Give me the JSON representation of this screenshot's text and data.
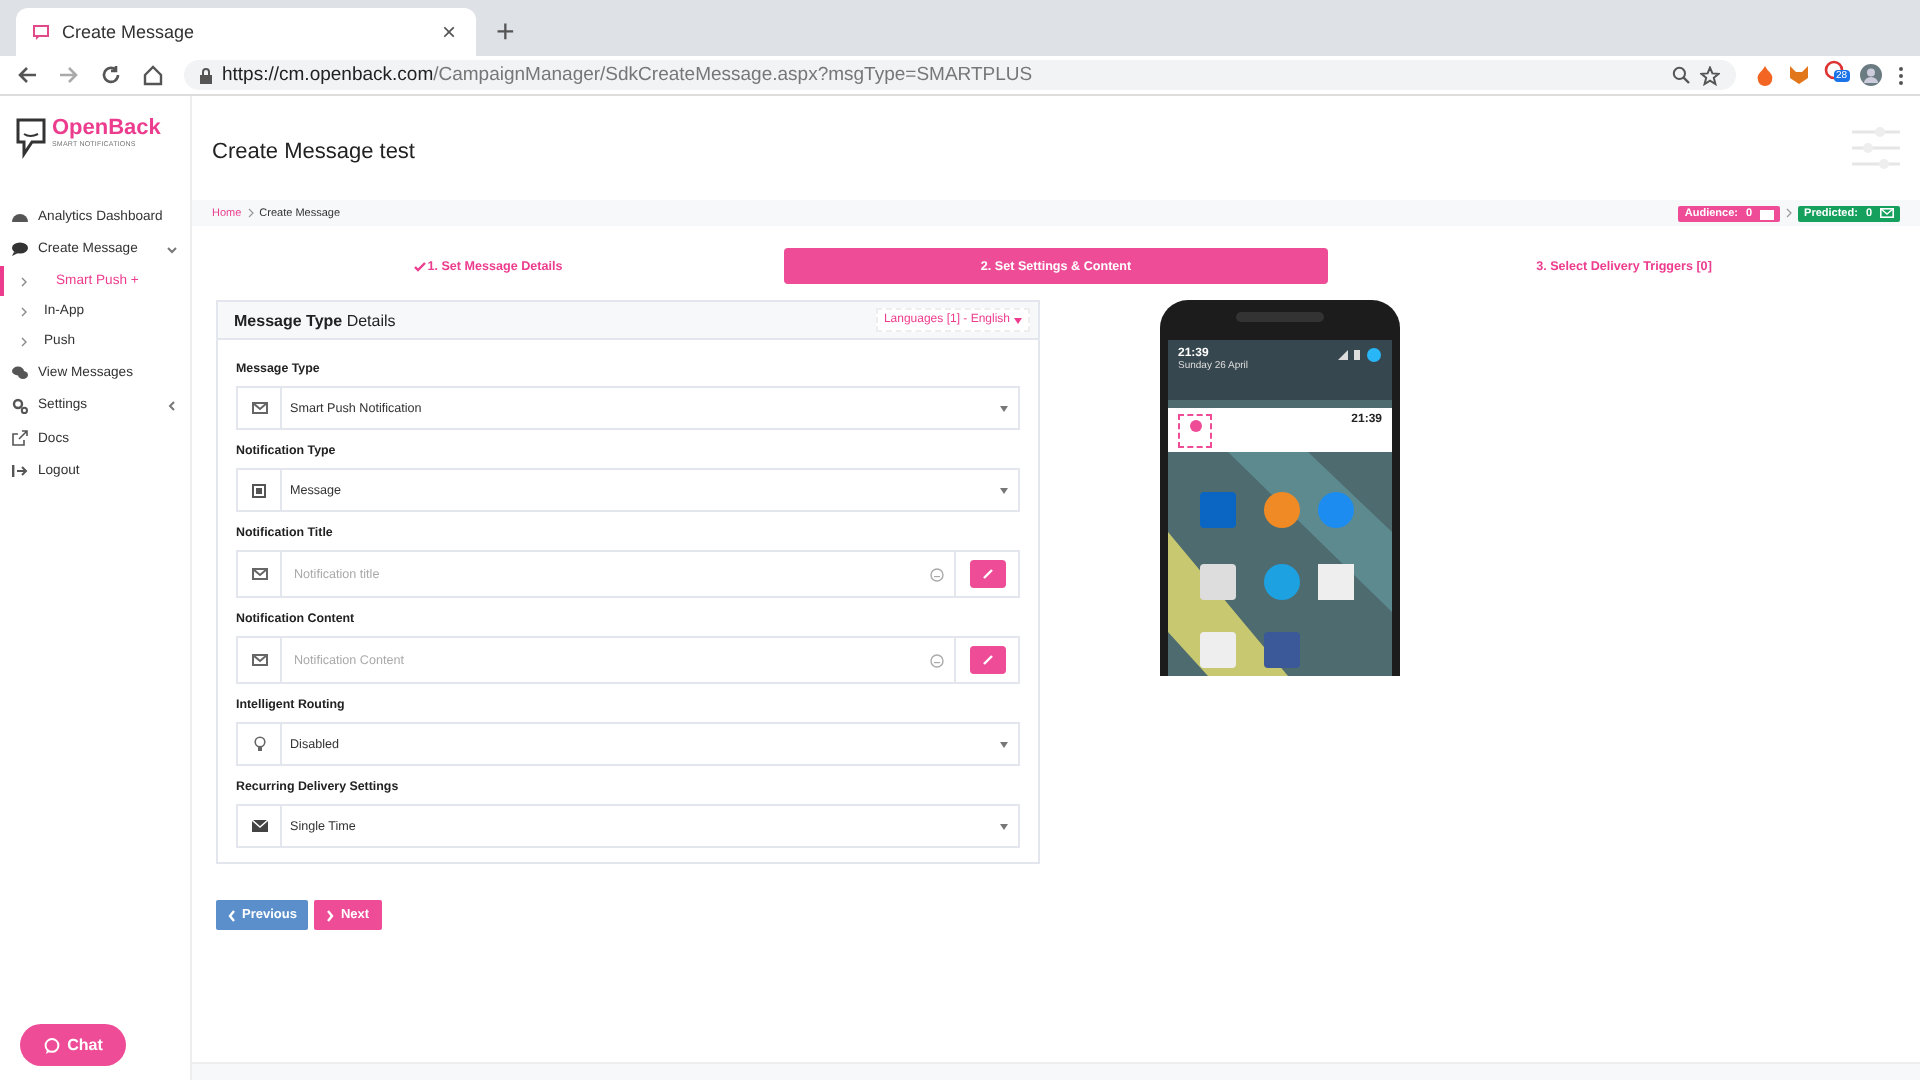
{
  "browser": {
    "tab_title": "Create Message",
    "tab_close": "×",
    "new_tab": "+",
    "url_host": "https://cm.openback.com",
    "url_path": "/CampaignManager/SdkCreateMessage.aspx?msgType=SMARTPLUS",
    "extension_badge": "28"
  },
  "sidebar": {
    "logo": "OpenBack",
    "logo_tagline": "SMART NOTIFICATIONS",
    "items": [
      {
        "kind": "link",
        "label": "Analytics Dashboard"
      },
      {
        "kind": "group",
        "label": "Create Message",
        "expanded": true,
        "children": [
          {
            "label": "Smart Push +",
            "selected": true
          },
          {
            "label": "In-App",
            "selected": false
          },
          {
            "label": "Push",
            "selected": false
          }
        ]
      },
      {
        "kind": "link",
        "label": "View Messages"
      },
      {
        "kind": "group",
        "label": "Settings",
        "expanded": false
      },
      {
        "kind": "link",
        "label": "Docs"
      },
      {
        "kind": "link",
        "label": "Logout"
      }
    ],
    "chat_button": "Chat"
  },
  "header": {
    "title": "Create Message test"
  },
  "breadcrumb": [
    "Home",
    "Create Message"
  ],
  "counters": [
    {
      "label": "Audience:",
      "value": "0",
      "color": "#ee4c97"
    },
    {
      "label": "Predicted:",
      "value": "0",
      "color": "#16a05d"
    }
  ],
  "steps": [
    {
      "label": "1. Set Message Details",
      "done": true,
      "selected": false
    },
    {
      "label": "2. Set Settings & Content",
      "done": false,
      "selected": true
    },
    {
      "label": "3. Select Delivery Triggers [0]",
      "done": false,
      "selected": false
    }
  ],
  "panel": {
    "title": "**Message Type** Details",
    "languages": "Languages [1] - English",
    "fields": [
      {
        "kind": "select",
        "label": "Message Type",
        "value": "Smart Push Notification"
      },
      {
        "kind": "select",
        "label": "Notification Type",
        "value": "Message"
      },
      {
        "kind": "text",
        "label": "Notification Title",
        "placeholder": "Notification title"
      },
      {
        "kind": "text",
        "label": "Notification Content",
        "placeholder": "Notification Content"
      },
      {
        "kind": "select",
        "label": "Intelligent Routing",
        "value": "Disabled"
      },
      {
        "kind": "select",
        "label": "Recurring Delivery Settings",
        "value": "Single Time"
      }
    ]
  },
  "buttons": [
    {
      "kind": "previous",
      "label": "Previous"
    },
    {
      "kind": "next",
      "label": "Next"
    }
  ],
  "phone": {
    "time": "21:39",
    "date": "Sunday 26 April",
    "notification_time": "21:39"
  }
}
